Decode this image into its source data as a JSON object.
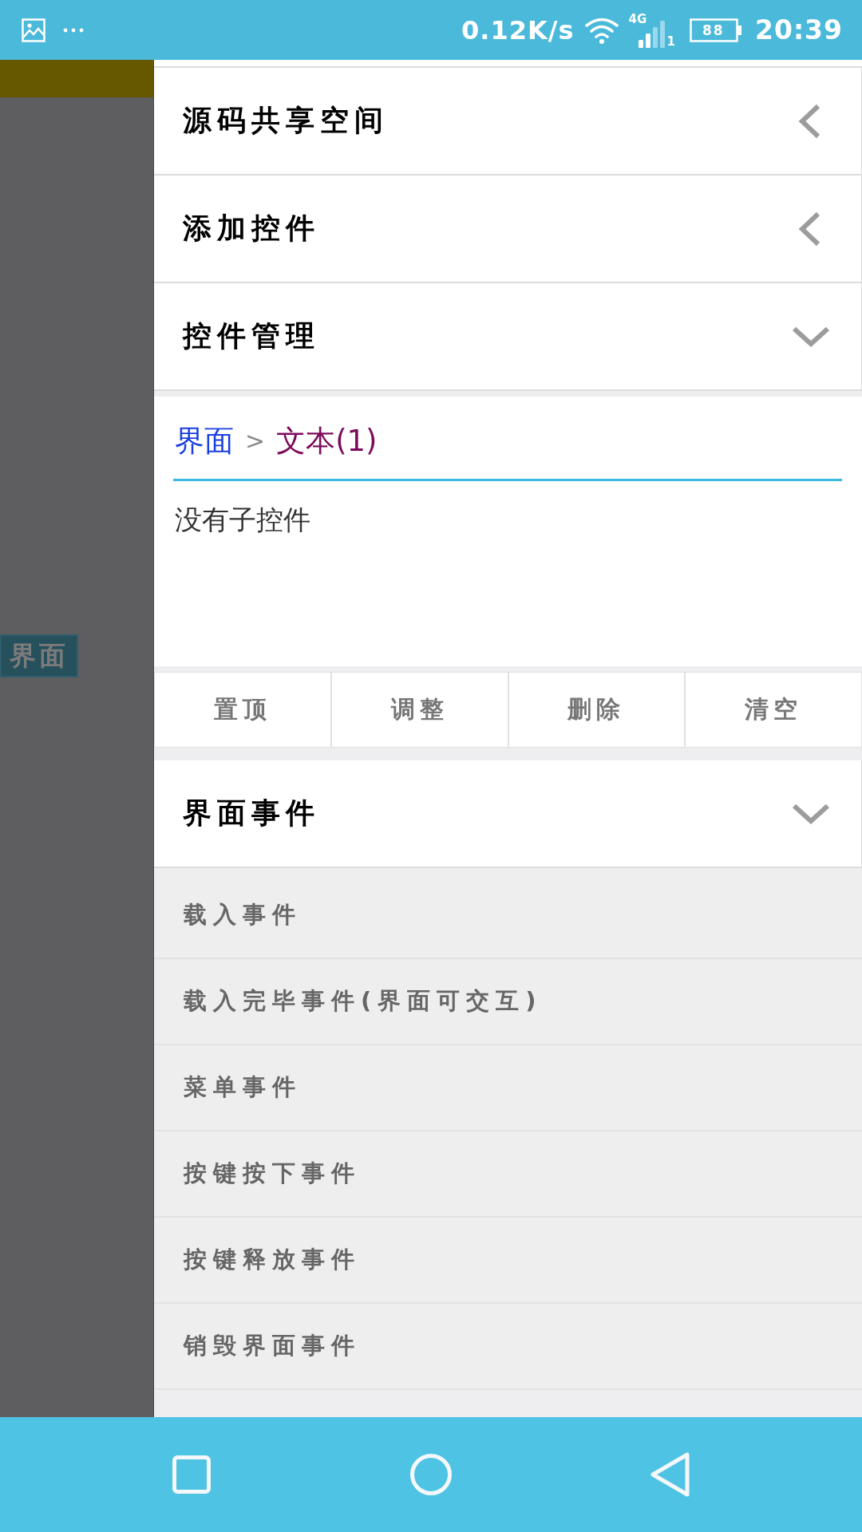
{
  "status_bar": {
    "net_speed": "0.12K/s",
    "network_type": "4G",
    "sim_slot": "1",
    "battery": "88",
    "time": "20:39"
  },
  "drawer_overlay": {
    "tag": "界面"
  },
  "sections": [
    {
      "title": "源码共享空间",
      "expanded": false
    },
    {
      "title": "添加控件",
      "expanded": false
    },
    {
      "title": "控件管理",
      "expanded": true,
      "kind": "control_tree",
      "breadcrumb": {
        "separator": ">",
        "items": [
          {
            "label": "界面",
            "selected": false
          },
          {
            "label": "文本(1)",
            "selected": true
          }
        ]
      },
      "empty_text": "没有子控件",
      "buttons": [
        "置顶",
        "调整",
        "删除",
        "清空"
      ]
    },
    {
      "title": "界面事件",
      "expanded": true,
      "kind": "event_list",
      "items": [
        "载入事件",
        "载入完毕事件(界面可交互)",
        "菜单事件",
        "按键按下事件",
        "按键释放事件",
        "销毁界面事件"
      ]
    }
  ]
}
